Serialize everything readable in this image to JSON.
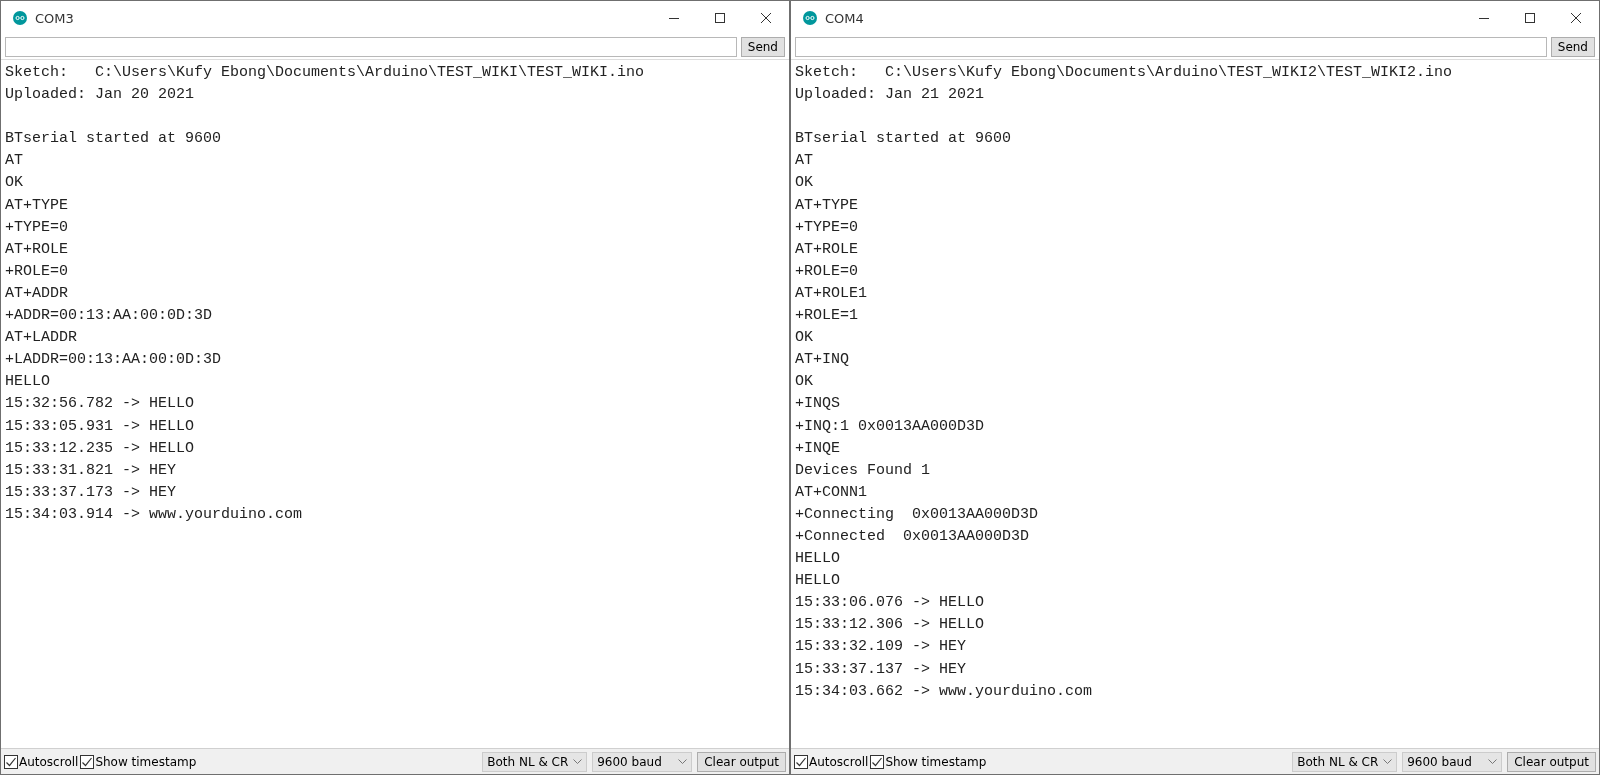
{
  "windows": [
    {
      "title": "COM3",
      "send_label": "Send",
      "header": [
        "Sketch:   C:\\Users\\Kufy Ebong\\Documents\\Arduino\\TEST_WIKI\\TEST_WIKI.ino",
        "Uploaded: Jan 20 2021"
      ],
      "log": [
        "BTserial started at 9600",
        "AT",
        "OK",
        "AT+TYPE",
        "+TYPE=0",
        "AT+ROLE",
        "+ROLE=0",
        "AT+ADDR",
        "+ADDR=00:13:AA:00:0D:3D",
        "AT+LADDR",
        "+LADDR=00:13:AA:00:0D:3D",
        "HELLO",
        "15:32:56.782 -> HELLO",
        "15:33:05.931 -> HELLO",
        "15:33:12.235 -> HELLO",
        "15:33:31.821 -> HEY",
        "15:33:37.173 -> HEY",
        "15:34:03.914 -> www.yourduino.com"
      ],
      "checkboxes": [
        {
          "label": "Autoscroll",
          "checked": true
        },
        {
          "label": "Show timestamp",
          "checked": true
        }
      ],
      "line_ending": "Both NL & CR",
      "baud": "9600 baud",
      "clear_label": "Clear output"
    },
    {
      "title": "COM4",
      "send_label": "Send",
      "header": [
        "Sketch:   C:\\Users\\Kufy Ebong\\Documents\\Arduino\\TEST_WIKI2\\TEST_WIKI2.ino",
        "Uploaded: Jan 21 2021"
      ],
      "log": [
        "BTserial started at 9600",
        "AT",
        "OK",
        "AT+TYPE",
        "+TYPE=0",
        "AT+ROLE",
        "+ROLE=0",
        "AT+ROLE1",
        "+ROLE=1",
        "OK",
        "AT+INQ",
        "OK",
        "+INQS",
        "+INQ:1 0x0013AA000D3D",
        "+INQE",
        "Devices Found 1",
        "AT+CONN1",
        "+Connecting  0x0013AA000D3D",
        "+Connected  0x0013AA000D3D",
        "HELLO",
        "HELLO",
        "15:33:06.076 -> HELLO",
        "15:33:12.306 -> HELLO",
        "15:33:32.109 -> HEY",
        "15:33:37.137 -> HEY",
        "15:34:03.662 -> www.yourduino.com"
      ],
      "checkboxes": [
        {
          "label": "Autoscroll",
          "checked": true
        },
        {
          "label": "Show timestamp",
          "checked": true
        }
      ],
      "line_ending": "Both NL & CR",
      "baud": "9600 baud",
      "clear_label": "Clear output"
    }
  ]
}
